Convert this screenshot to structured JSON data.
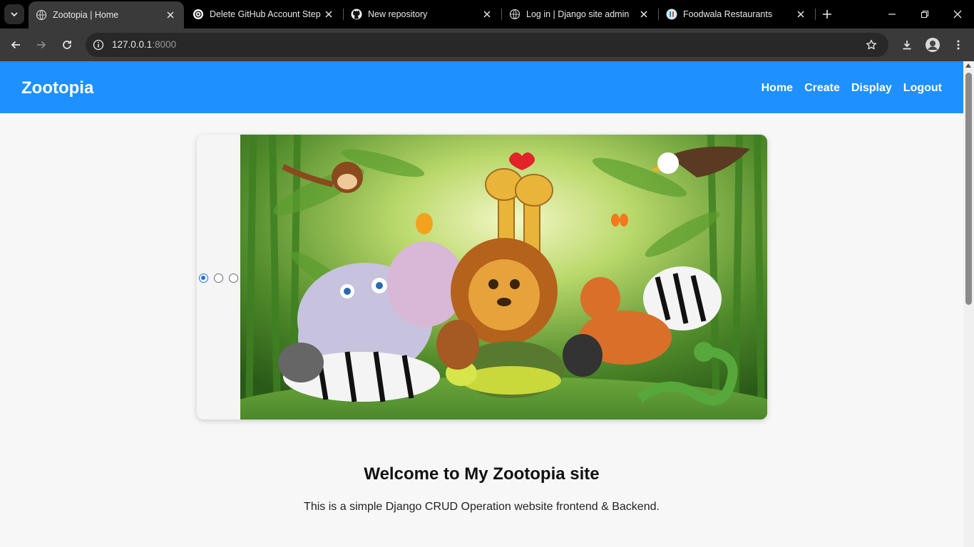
{
  "browser": {
    "tabs": [
      {
        "title": "Zootopia | Home",
        "icon": "globe-icon",
        "active": true
      },
      {
        "title": "Delete GitHub Account Step",
        "icon": "openai-icon",
        "active": false
      },
      {
        "title": "New repository",
        "icon": "github-icon",
        "active": false
      },
      {
        "title": "Log in | Django site admin",
        "icon": "globe-icon",
        "active": false
      },
      {
        "title": "Foodwala Restaurants",
        "icon": "foodwala-icon",
        "active": false
      }
    ],
    "url_host": "127.0.0.1",
    "url_port": ":8000"
  },
  "site": {
    "brand": "Zootopia",
    "menu": [
      "Home",
      "Create",
      "Display",
      "Logout"
    ],
    "nav_color": "#1e90ff"
  },
  "slider": {
    "slide_count": 3,
    "selected_index": 0
  },
  "main": {
    "heading": "Welcome to My Zootopia site",
    "intro": "This is a simple Django CRUD Operation website frontend & Backend."
  }
}
